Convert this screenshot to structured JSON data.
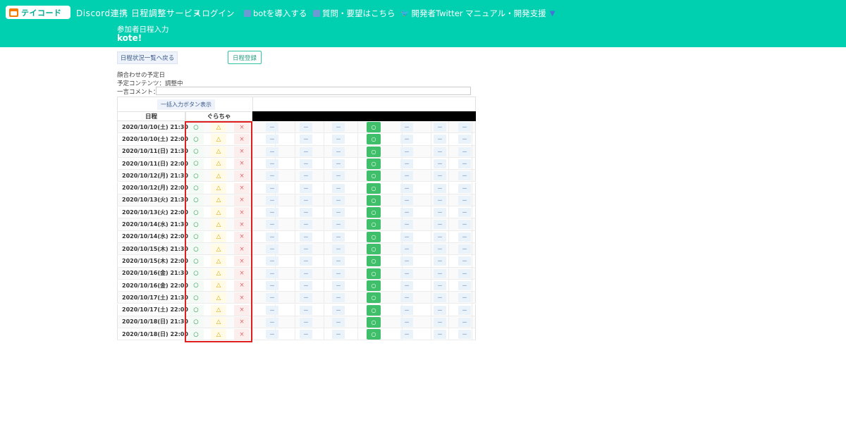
{
  "header": {
    "logo_text": "テイコード",
    "brand": "Discord連携 日程調整サービス",
    "nav": {
      "login": "ログイン",
      "invite_bot": "botを導入する",
      "questions": "質問・要望はこちら",
      "twitter": "開発者Twitter",
      "manual": "マニュアル・開発支援"
    },
    "subtitle": "参加者日程入力",
    "title": "kote!"
  },
  "toolbar": {
    "back_label": "日程状況一覧へ戻る",
    "register_label": "日程登録"
  },
  "info": {
    "meeting_date": "顔合わせの予定日",
    "content": "予定コンテンツ：調整中",
    "comment_label": "一言コメント："
  },
  "table": {
    "bulk_button": "一括入力ボタン表示",
    "date_header": "日程",
    "user_header": "ぐらちゃ",
    "ok_symbol": "○",
    "maybe_symbol": "△",
    "no_symbol": "×",
    "other_symbol": "－",
    "rows": [
      "2020/10/10(土) 21:30~",
      "2020/10/10(土) 22:00~",
      "2020/10/11(日) 21:30~",
      "2020/10/11(日) 22:00~",
      "2020/10/12(月) 21:30~",
      "2020/10/12(月) 22:00~",
      "2020/10/13(火) 21:30~",
      "2020/10/13(火) 22:00~",
      "2020/10/14(水) 21:30~",
      "2020/10/14(水) 22:00~",
      "2020/10/15(木) 21:30~",
      "2020/10/15(木) 22:00~",
      "2020/10/16(金) 21:30~",
      "2020/10/16(金) 22:00~",
      "2020/10/17(土) 21:30~",
      "2020/10/17(土) 22:00~",
      "2020/10/18(日) 21:30~",
      "2020/10/18(日) 22:00~"
    ]
  },
  "colors": {
    "header_bg": "#00cfb0",
    "highlight": "#e02020",
    "green_badge": "#3fbf6a"
  }
}
